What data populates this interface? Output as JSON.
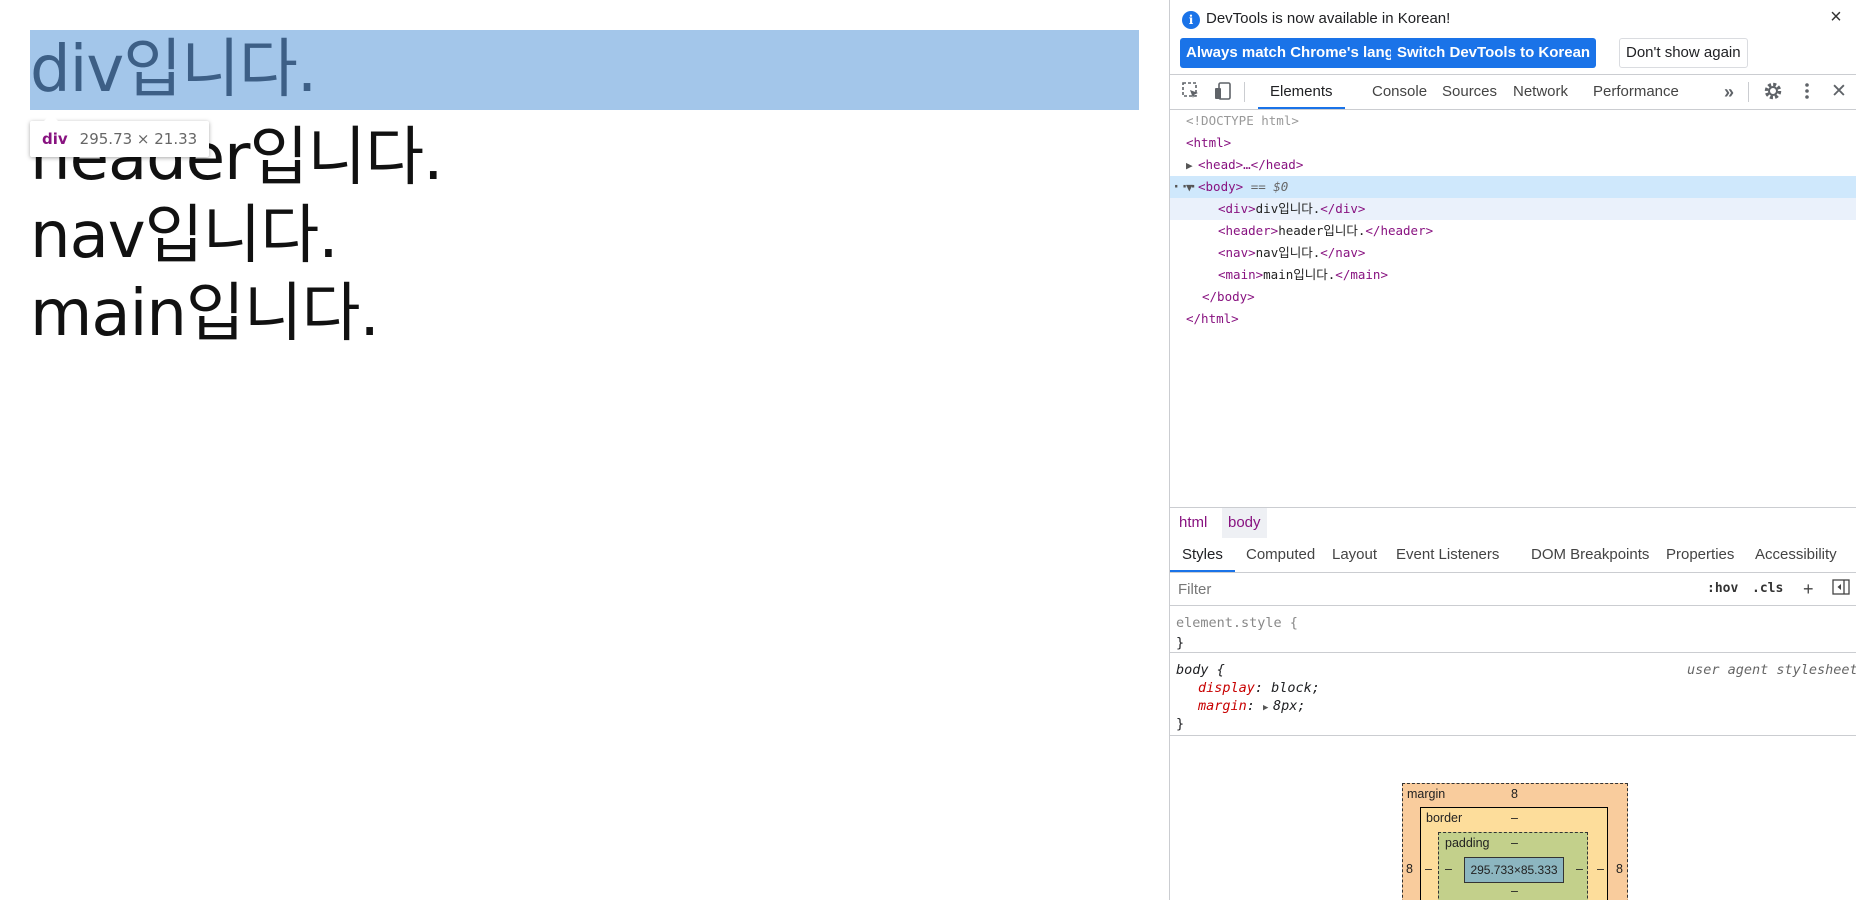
{
  "page": {
    "lines": [
      "div입니다.",
      "header입니다.",
      "nav입니다.",
      "main입니다."
    ]
  },
  "inspect_tooltip": {
    "tag": "div",
    "dims": "295.73 × 21.33"
  },
  "devtools": {
    "infobar": {
      "message": "DevTools is now available in Korean!",
      "btn_match": "Always match Chrome's language",
      "btn_switch": "Switch DevTools to Korean",
      "btn_dont_show": "Don't show again"
    },
    "tabs": [
      "Elements",
      "Console",
      "Sources",
      "Network",
      "Performance"
    ],
    "more_tabs_icon": "»",
    "dom": {
      "doctype": "<!DOCTYPE html>",
      "html_open": "<html>",
      "head": "<head>…</head>",
      "body_open": "<body>",
      "body_eq": "== $0",
      "div_open": "<div>",
      "div_text": "div입니다.",
      "div_close": "</div>",
      "header_open": "<header>",
      "header_text": "header입니다.",
      "header_close": "</header>",
      "nav_open": "<nav>",
      "nav_text": "nav입니다.",
      "nav_close": "</nav>",
      "main_open": "<main>",
      "main_text": "main입니다.",
      "main_close": "</main>",
      "body_close": "</body>",
      "html_close": "</html>"
    },
    "breadcrumbs": [
      "html",
      "body"
    ],
    "subtabs": [
      "Styles",
      "Computed",
      "Layout",
      "Event Listeners",
      "DOM Breakpoints",
      "Properties",
      "Accessibility"
    ],
    "filter": {
      "placeholder": "Filter",
      "hov": ":hov",
      "cls": ".cls",
      "add": "+"
    },
    "rules": {
      "element_style": "element.style {",
      "close_brace": "}",
      "body_selector": "body {",
      "source": "user agent stylesheet",
      "display_prop": "display",
      "display_val": "block;",
      "margin_prop": "margin",
      "margin_val": "8px;"
    },
    "box_model": {
      "margin_label": "margin",
      "margin_top": "8",
      "margin_left": "8",
      "margin_right": "8",
      "border_label": "border",
      "border_top": "–",
      "border_left": "–",
      "border_right": "–",
      "padding_label": "padding",
      "padding_top": "–",
      "padding_left": "–",
      "padding_right": "–",
      "padding_bottom": "–",
      "content": "295.733×85.333"
    }
  }
}
